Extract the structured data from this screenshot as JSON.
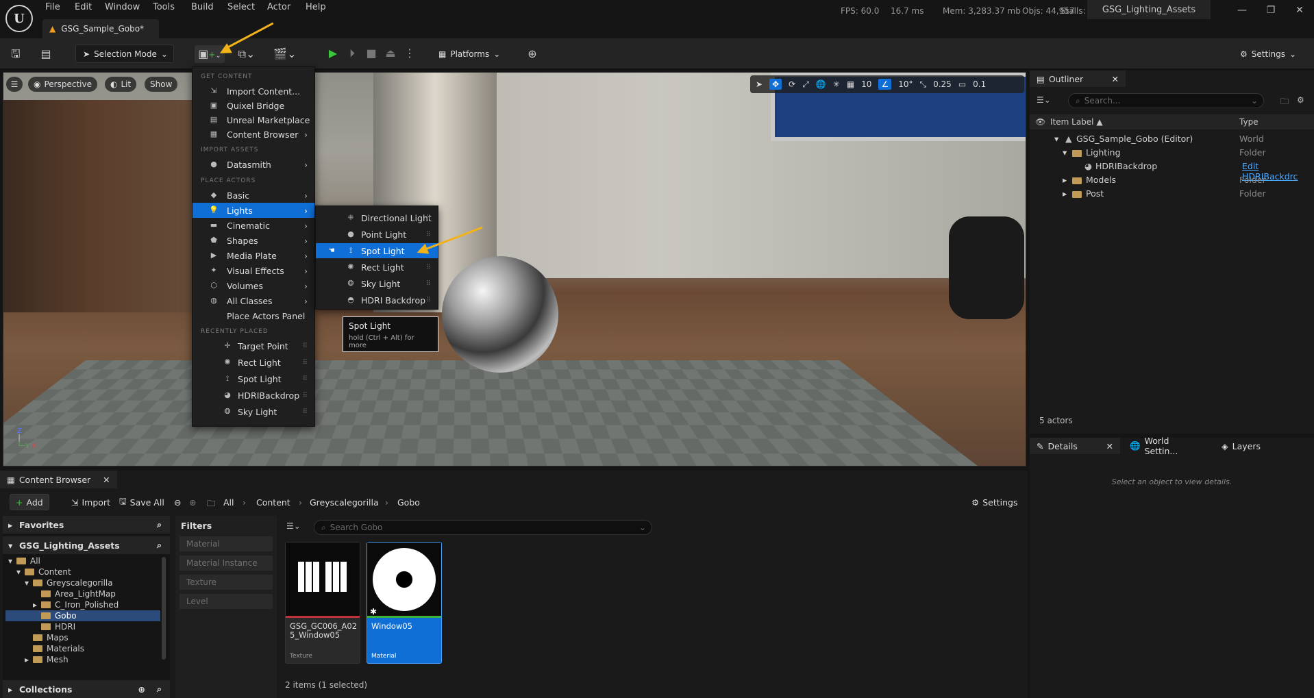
{
  "menubar": {
    "items": [
      "File",
      "Edit",
      "Window",
      "Tools",
      "Build",
      "Select",
      "Actor",
      "Help"
    ]
  },
  "stats": {
    "fps": "FPS: 60.0",
    "ms": "16.7 ms",
    "mem": "Mem: 3,283.37 mb",
    "objs": "Objs: 44,957",
    "stalls": "Stalls: 14"
  },
  "project_tab": "GSG_Lighting_Assets",
  "doc_tab": "GSG_Sample_Gobo*",
  "toolbar": {
    "selection_mode": "Selection Mode",
    "platforms": "Platforms",
    "settings": "Settings"
  },
  "viewport": {
    "perspective": "Perspective",
    "lit": "Lit",
    "show": "Show",
    "grid": "10",
    "angle": "10°",
    "scale": "0.25",
    "camera": "0.1"
  },
  "add_menu": {
    "sec_get": "GET CONTENT",
    "import": "Import Content...",
    "quixel": "Quixel Bridge",
    "marketplace": "Unreal Marketplace",
    "content_browser": "Content Browser",
    "sec_import": "IMPORT ASSETS",
    "datasmith": "Datasmith",
    "sec_place": "PLACE ACTORS",
    "basic": "Basic",
    "lights": "Lights",
    "cinematic": "Cinematic",
    "shapes": "Shapes",
    "media_plate": "Media Plate",
    "visual_effects": "Visual Effects",
    "volumes": "Volumes",
    "all_classes": "All Classes",
    "place_actors_panel": "Place Actors Panel",
    "sec_recent": "RECENTLY PLACED",
    "recent": [
      "Target Point",
      "Rect Light",
      "Spot Light",
      "HDRIBackdrop",
      "Sky Light"
    ]
  },
  "lights_menu": [
    "Directional Light",
    "Point Light",
    "Spot Light",
    "Rect Light",
    "Sky Light",
    "HDRI Backdrop"
  ],
  "tooltip": {
    "title": "Spot Light",
    "hint": "hold (Ctrl + Alt) for more"
  },
  "outliner": {
    "tab": "Outliner",
    "search_placeholder": "Search...",
    "col_label": "Item Label ▲",
    "col_type": "Type",
    "rows": [
      {
        "name": "GSG_Sample_Gobo (Editor)",
        "type": "World"
      },
      {
        "name": "Lighting",
        "type": "Folder"
      },
      {
        "name": "HDRIBackdrop",
        "type": "Edit HDRIBackdrc"
      },
      {
        "name": "Models",
        "type": "Folder"
      },
      {
        "name": "Post",
        "type": "Folder"
      }
    ],
    "actors_count": "5 actors"
  },
  "details": {
    "tab_details": "Details",
    "tab_world": "World Settin...",
    "tab_layers": "Layers",
    "empty": "Select an object to view details."
  },
  "content_browser": {
    "tab": "Content Browser",
    "add": "Add",
    "import": "Import",
    "save_all": "Save All",
    "crumbs": [
      "All",
      "Content",
      "Greyscalegorilla",
      "Gobo"
    ],
    "settings": "Settings",
    "favorites": "Favorites",
    "project": "GSG_Lighting_Assets",
    "tree": [
      "All",
      "Content",
      "Greyscalegorilla",
      "Area_LightMap",
      "C_Iron_Polished",
      "Gobo",
      "HDRI",
      "Maps",
      "Materials",
      "Mesh"
    ],
    "collections": "Collections",
    "filters_title": "Filters",
    "filters": [
      "Material",
      "Material Instance",
      "Texture",
      "Level"
    ],
    "search_placeholder": "Search Gobo",
    "assets": [
      {
        "name": "GSG_GC006_A025_Window05",
        "kind": "Texture"
      },
      {
        "name": "Window05",
        "kind": "Material"
      }
    ],
    "count": "2 items (1 selected)"
  }
}
